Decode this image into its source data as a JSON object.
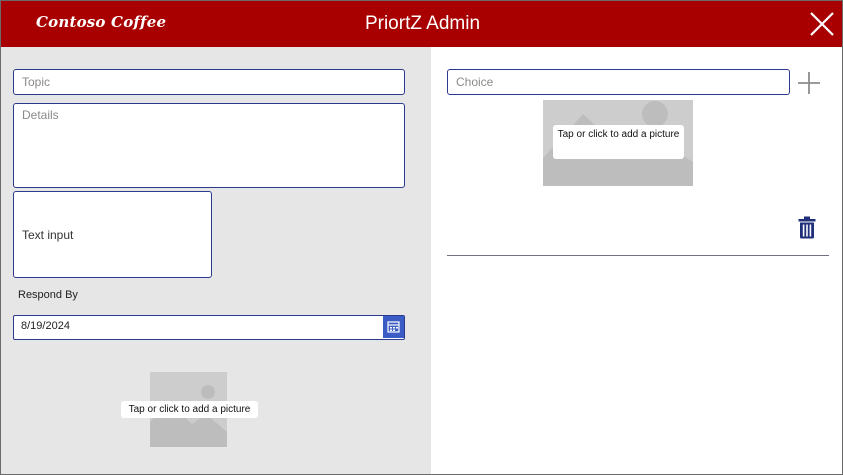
{
  "header": {
    "logo_text": "Contoso Coffee",
    "title": "PriortZ Admin",
    "close_icon": "close-icon",
    "background_color": "#a80000"
  },
  "form": {
    "topic_placeholder": "Topic",
    "details_placeholder": "Details",
    "text_input_value": "Text input",
    "respond_by_label": "Respond By",
    "respond_by_date": "8/19/2024",
    "calendar_icon": "calendar-icon",
    "picture_prompt": "Tap or click to add a picture"
  },
  "choices": {
    "choice_placeholder": "Choice",
    "add_icon": "plus-icon",
    "picture_prompt": "Tap or click to add a picture",
    "delete_icon": "trash-icon"
  },
  "colors": {
    "accent_border": "#2b3a8c",
    "calendar_button": "#3b5cc4",
    "left_pane_bg": "#e6e6e6"
  }
}
